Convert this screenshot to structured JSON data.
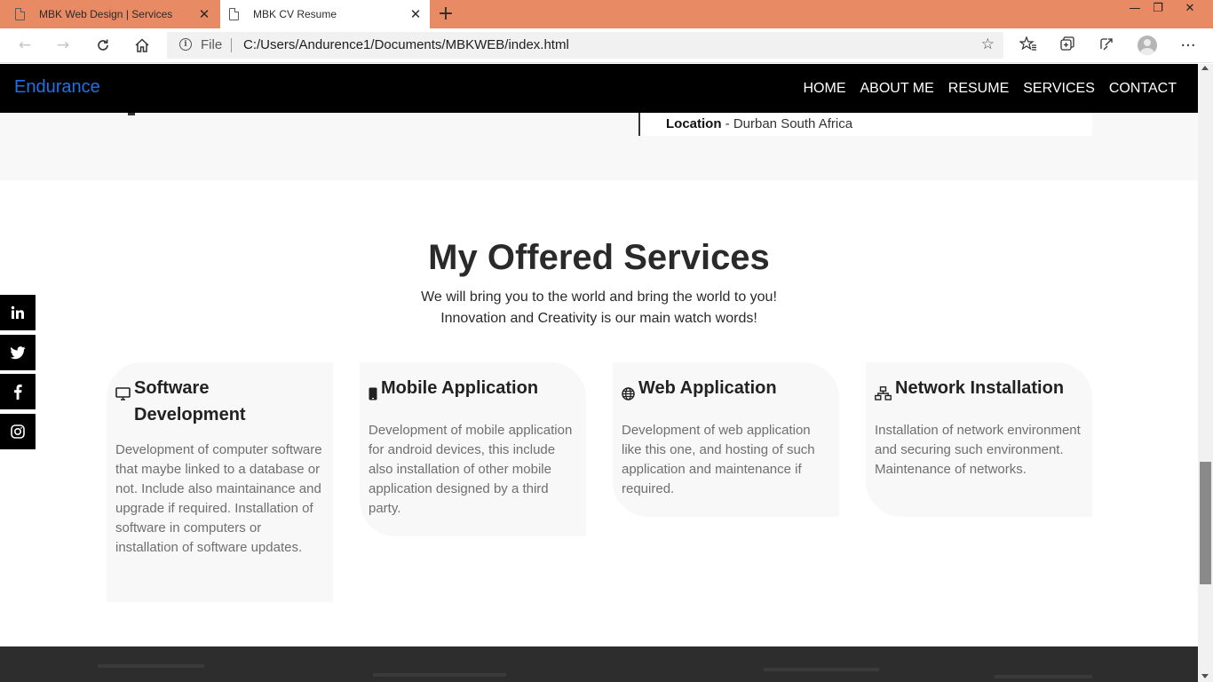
{
  "browser": {
    "tabs": [
      {
        "title": "MBK Web Design | Services",
        "active": false
      },
      {
        "title": "MBK CV Resume",
        "active": true
      }
    ],
    "new_tab_glyph": "+",
    "window_controls": {
      "minimize": "—",
      "restore": "❐",
      "close": "✕"
    },
    "address": {
      "scheme_label": "File",
      "url": "C:/Users/Andurence1/Documents/MBKWEB/index.html"
    },
    "icons": [
      "back-icon",
      "forward-icon",
      "refresh-icon",
      "home-icon",
      "info-icon",
      "favorite-star-icon",
      "favorites-icon",
      "collections-icon",
      "share-icon",
      "profile-avatar",
      "more-icon"
    ]
  },
  "site": {
    "brand": "Endurance",
    "menu": [
      "HOME",
      "ABOUT ME",
      "RESUME",
      "SERVICES",
      "CONTACT"
    ],
    "colors": {
      "brand": "#1a73e8",
      "nav_bg": "#000000",
      "card_bg": "#f8f8f8"
    }
  },
  "resume": {
    "location_label": "Location",
    "location_value": " - Durban South Africa"
  },
  "services": {
    "title": "My Offered Services",
    "subtitle_line1": "We will bring you to the world and bring the world to you!",
    "subtitle_line2": "Innovation and Creativity is our main watch words!",
    "cards": [
      {
        "icon": "desktop-icon",
        "title": "Software Development",
        "text": "Development of computer software that maybe linked to a database or not. Include also maintainance and upgrade if required. Installation of software in computers or installation of software updates."
      },
      {
        "icon": "mobile-icon",
        "title": "Mobile Application",
        "text": "Development of mobile application for android devices, this include also installation of other mobile application designed by a third party."
      },
      {
        "icon": "globe-icon",
        "title": "Web Application",
        "text": "Development of web application like this one, and hosting of such application and maintenance if required."
      },
      {
        "icon": "network-icon",
        "title": "Network Installation",
        "text": "Installation of network environment and securing such environment. Maintenance of networks."
      }
    ]
  },
  "social": [
    "linkedin-icon",
    "twitter-icon",
    "facebook-icon",
    "instagram-icon"
  ]
}
